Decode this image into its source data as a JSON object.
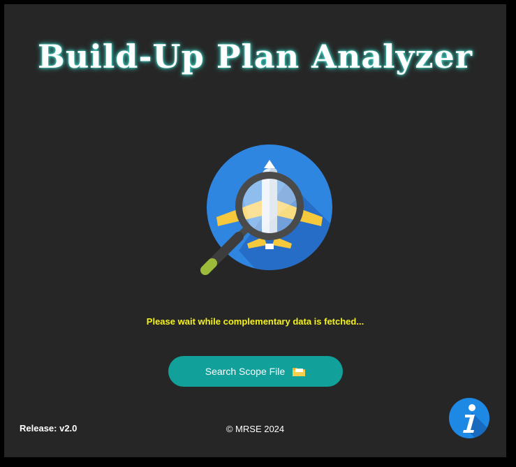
{
  "app": {
    "title": "Build-Up Plan Analyzer"
  },
  "logo": {
    "icon": "aircraft-magnifier-icon"
  },
  "status": {
    "message": "Please wait while complementary data is fetched..."
  },
  "actions": {
    "search_label": "Search Scope File",
    "search_icon": "folder-icon",
    "info_icon": "info-icon"
  },
  "footer": {
    "release": "Release: v2.0",
    "copyright": "© MRSE 2024"
  },
  "colors": {
    "background": "#262626",
    "accent": "#12a09a",
    "status_text": "#f5f31c",
    "title_glow": "#3fe0d0",
    "info_blue": "#1e88e5"
  }
}
